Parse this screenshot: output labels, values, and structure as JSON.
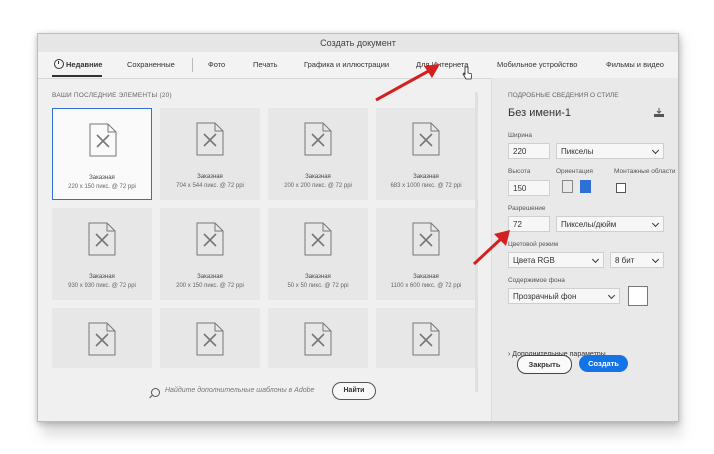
{
  "window": {
    "title": "Создать документ"
  },
  "tabs": [
    {
      "label": "Недавние"
    },
    {
      "label": "Сохраненные"
    },
    {
      "label": "Фото"
    },
    {
      "label": "Печать"
    },
    {
      "label": "Графика и иллюстрации"
    },
    {
      "label": "Для Интернета"
    },
    {
      "label": "Мобильное устройство"
    },
    {
      "label": "Фильмы и видео"
    }
  ],
  "recent": {
    "heading": "ВАШИ ПОСЛЕДНИЕ ЭЛЕМЕНТЫ",
    "count": "(20)",
    "items": [
      {
        "name": "Заказная",
        "size": "220 x 150 пикс. @ 72 ppi"
      },
      {
        "name": "Заказная",
        "size": "704 x 544 пикс. @ 72 ppi"
      },
      {
        "name": "Заказная",
        "size": "200 x 200 пикс. @ 72 ppi"
      },
      {
        "name": "Заказная",
        "size": "683 x 1000 пикс. @ 72 ppi"
      },
      {
        "name": "Заказная",
        "size": "930 x 930 пикс. @ 72 ppi"
      },
      {
        "name": "Заказная",
        "size": "200 x 150 пикс. @ 72 ppi"
      },
      {
        "name": "Заказная",
        "size": "50 x 50 пикс. @ 72 ppi"
      },
      {
        "name": "Заказная",
        "size": "1100 x 600 пикс. @ 72 ppi"
      }
    ]
  },
  "search": {
    "placeholder": "Найдите дополнительные шаблоны в Adobe",
    "button": "Найти"
  },
  "details": {
    "title": "ПОДРОБНЫЕ СВЕДЕНИЯ О СТИЛЕ",
    "doc_name": "Без имени-1",
    "width_label": "Ширина",
    "width_value": "220",
    "width_unit": "Пикселы",
    "height_label": "Высота",
    "height_value": "150",
    "orientation_label": "Ориентация",
    "artboards_label": "Монтажные области",
    "resolution_label": "Разрешение",
    "resolution_value": "72",
    "resolution_unit": "Пикселы/дюйм",
    "color_mode_label": "Цветовой режим",
    "color_mode": "Цвета RGB",
    "bit_depth": "8 бит",
    "bg_label": "Содержимое фона",
    "bg_value": "Прозрачный фон",
    "advanced": "Дополнительные параметры"
  },
  "buttons": {
    "close": "Закрыть",
    "create": "Создать"
  },
  "colors": {
    "accent": "#1473e6",
    "annotation_arrow": "#d42020"
  }
}
